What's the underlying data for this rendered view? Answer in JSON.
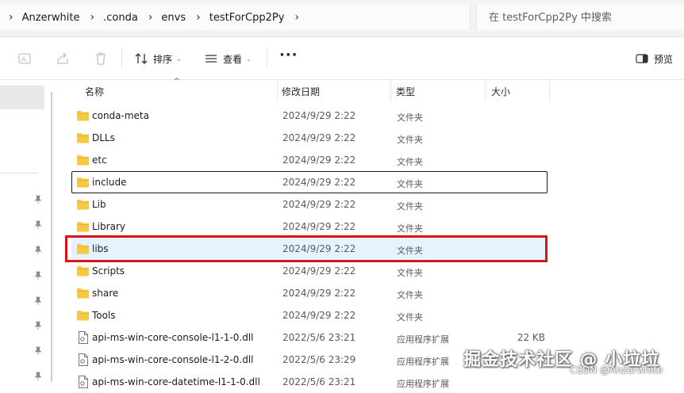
{
  "breadcrumb": [
    "Anzerwhite",
    ".conda",
    "envs",
    "testForCpp2Py"
  ],
  "search": {
    "placeholder": "在 testForCpp2Py 中搜索"
  },
  "toolbar": {
    "sort_label": "排序",
    "view_label": "查看",
    "more_label": "···",
    "preview_label": "预览"
  },
  "columns": {
    "name": "名称",
    "date": "修改日期",
    "type": "类型",
    "size": "大小"
  },
  "files": [
    {
      "name": "conda-meta",
      "date": "2024/9/29 2:22",
      "type": "文件夹",
      "size": "",
      "kind": "folder"
    },
    {
      "name": "DLLs",
      "date": "2024/9/29 2:22",
      "type": "文件夹",
      "size": "",
      "kind": "folder"
    },
    {
      "name": "etc",
      "date": "2024/9/29 2:22",
      "type": "文件夹",
      "size": "",
      "kind": "folder"
    },
    {
      "name": "include",
      "date": "2024/9/29 2:22",
      "type": "文件夹",
      "size": "",
      "kind": "folder",
      "focused": true
    },
    {
      "name": "Lib",
      "date": "2024/9/29 2:22",
      "type": "文件夹",
      "size": "",
      "kind": "folder"
    },
    {
      "name": "Library",
      "date": "2024/9/29 2:22",
      "type": "文件夹",
      "size": "",
      "kind": "folder"
    },
    {
      "name": "libs",
      "date": "2024/9/29 2:22",
      "type": "文件夹",
      "size": "",
      "kind": "folder",
      "selected": true
    },
    {
      "name": "Scripts",
      "date": "2024/9/29 2:22",
      "type": "文件夹",
      "size": "",
      "kind": "folder"
    },
    {
      "name": "share",
      "date": "2024/9/29 2:22",
      "type": "文件夹",
      "size": "",
      "kind": "folder"
    },
    {
      "name": "Tools",
      "date": "2024/9/29 2:22",
      "type": "文件夹",
      "size": "",
      "kind": "folder"
    },
    {
      "name": "api-ms-win-core-console-l1-1-0.dll",
      "date": "2022/5/6 23:21",
      "type": "应用程序扩展",
      "size": "22 KB",
      "kind": "dll"
    },
    {
      "name": "api-ms-win-core-console-l1-2-0.dll",
      "date": "2022/5/6 23:29",
      "type": "应用程序扩展",
      "size": "",
      "kind": "dll"
    },
    {
      "name": "api-ms-win-core-datetime-l1-1-0.dll",
      "date": "2022/5/6 23:21",
      "type": "应用程序扩展",
      "size": "",
      "kind": "dll"
    }
  ],
  "watermark": {
    "main": "掘金技术社区 @ 小垃垃",
    "sub": "CSDN @Anzerwhite"
  },
  "colors": {
    "selection": "#e5f3ff",
    "highlight_box": "#d9131a",
    "folder": "#f8c93e"
  }
}
